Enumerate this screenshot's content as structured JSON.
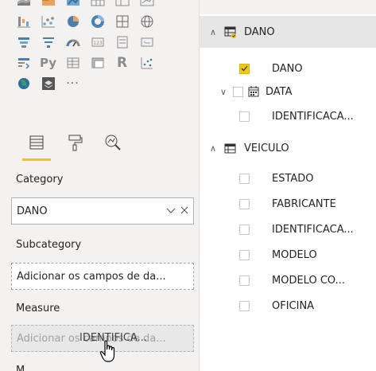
{
  "visualizations": {
    "icon_rows": [
      [
        "stacked-area-icon",
        "filled-map-icon",
        "map-icon",
        "table-icon",
        "matrix-icon",
        "kpi-icon"
      ],
      [
        "waterfall-icon",
        "scatter-icon",
        "pie-icon",
        "donut-icon",
        "treemap-icon",
        "globe-icon"
      ],
      [
        "funnel-icon",
        "filter-icon",
        "gauge-icon",
        "card-icon",
        "multirow-card-icon",
        "slicer-icon"
      ],
      [
        "key-influencers-icon",
        "python-visual-icon",
        "table-visual-icon",
        "matrix-visual-icon",
        "r-visual-icon",
        "arcgis-icon"
      ],
      [
        "globe-map-icon",
        "custom-visual-icon",
        "more-visuals-icon"
      ]
    ],
    "python_label": "Py",
    "r_label": "R",
    "more_label": "···",
    "tabs": [
      "fields-tab-icon",
      "format-tab-icon",
      "analytics-tab-icon"
    ],
    "active_tab": 0,
    "wells": {
      "category_label": "Category",
      "category_value": "DANO",
      "subcategory_label": "Subcategory",
      "subcategory_placeholder": "Adicionar os campos de da...",
      "measure_label": "Measure",
      "measure_placeholder": "Adicionar os campos de da...",
      "next_label_partial": "M"
    },
    "drag_ghost": "IDENTIFICA...",
    "accent_color": "#f2c811"
  },
  "fields": {
    "tables": [
      {
        "name": "DANO",
        "expanded": true,
        "selected": true,
        "fields": [
          {
            "name": "DANO",
            "checked": true
          }
        ],
        "hierarchies": [
          {
            "name": "DATA",
            "expanded": true,
            "children": [
              {
                "name": "IDENTIFICACA...",
                "checked": false
              }
            ]
          }
        ]
      },
      {
        "name": "VEICULO",
        "expanded": true,
        "selected": false,
        "fields": [
          {
            "name": "ESTADO",
            "checked": false
          },
          {
            "name": "FABRICANTE",
            "checked": false
          },
          {
            "name": "IDENTIFICACA...",
            "checked": false
          },
          {
            "name": "MODELO",
            "checked": false
          },
          {
            "name": "MODELO CO...",
            "checked": false
          },
          {
            "name": "OFICINA",
            "checked": false
          }
        ]
      }
    ],
    "chevron_expanded": "∧",
    "chevron_sub": "∨"
  }
}
